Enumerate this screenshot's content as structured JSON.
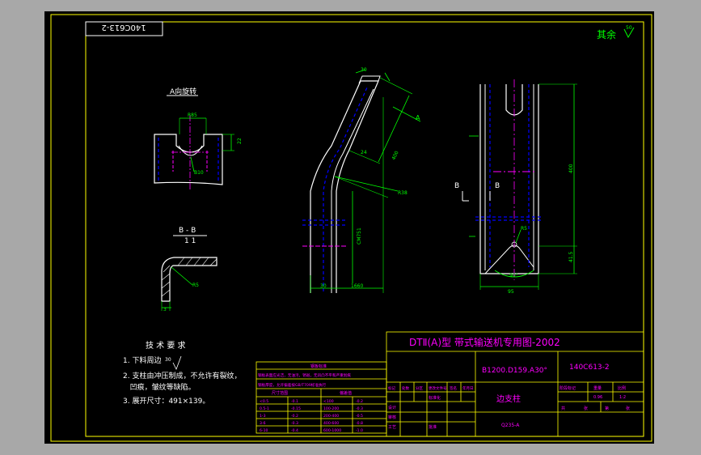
{
  "colors": {
    "background": "#000000",
    "chrome": "#a8a8a8",
    "frame": "#ffff00",
    "outline": "#ffffff",
    "dimension": "#00ff00",
    "hidden": "#ff00ff",
    "center": "#ff00ff",
    "axis": "#0000ff",
    "text": "#ffffff",
    "table_text": "#ff00ff"
  },
  "drawing": {
    "label_box": "140C613-2",
    "surface_note": "其余",
    "surface_value": "50"
  },
  "view_a": {
    "title": "A向旋转",
    "dims": [
      "R85",
      "22",
      "B10"
    ]
  },
  "view_b": {
    "title": "B - B",
    "subtitle": "1 1",
    "dims": [
      "R5",
      "3"
    ]
  },
  "main_view": {
    "dims": [
      "30",
      "A",
      "24",
      "R38",
      "400",
      "CM751",
      "30",
      "1660"
    ]
  },
  "side_view": {
    "dims": [
      "B",
      "B",
      "400",
      "R5",
      "90°",
      "41.5",
      "95"
    ]
  },
  "tech_req": {
    "title": "技 术 要 求",
    "items": [
      "1. 下料周边",
      "2. 支柱由冲压制成，不允许有裂纹，",
      "   凹痕，皱纹等缺陷。",
      "3. 展开尺寸：491×139。"
    ],
    "item1_suffix": "30"
  },
  "param_table": {
    "title": "钢板标准",
    "note1": "钢板表面应光洁，无油污，锈斑，无凹凸不平和严重划痕",
    "note2": "钢板厚度，允许偏差按GB/T709标准执行",
    "header": [
      "尺寸范围",
      "偏差值"
    ],
    "rows": [
      [
        "<0.5",
        "-0.1",
        "<100",
        "-0.2"
      ],
      [
        "0.5-1",
        "-0.15",
        "100-200",
        "-0.3"
      ],
      [
        "1-3",
        "-0.2",
        "200-400",
        "-0.5"
      ],
      [
        "3-6",
        "-0.3",
        "400-600",
        "-0.8"
      ],
      [
        "6-10",
        "-0.4",
        "600-1000",
        "-1.0"
      ]
    ]
  },
  "title_block": {
    "title": "DTⅡ(A)型  带式输送机专用图-2002",
    "model": "B1200.D159.A30°",
    "code": "140C613-2",
    "part_name": "边支柱",
    "material": "Q235-A",
    "rev_headers": [
      "标记",
      "处数",
      "分区",
      "更改文件号",
      "签名",
      "年月日"
    ],
    "sign_rows": [
      "设计",
      "审核",
      "工艺",
      "批准"
    ],
    "std": "标准化",
    "stage_headers": [
      "阶段标记",
      "重量",
      "比例"
    ],
    "weight": "0.96",
    "scale": "1:2",
    "sheet_labels": [
      "共",
      "张",
      "第",
      "张"
    ]
  }
}
